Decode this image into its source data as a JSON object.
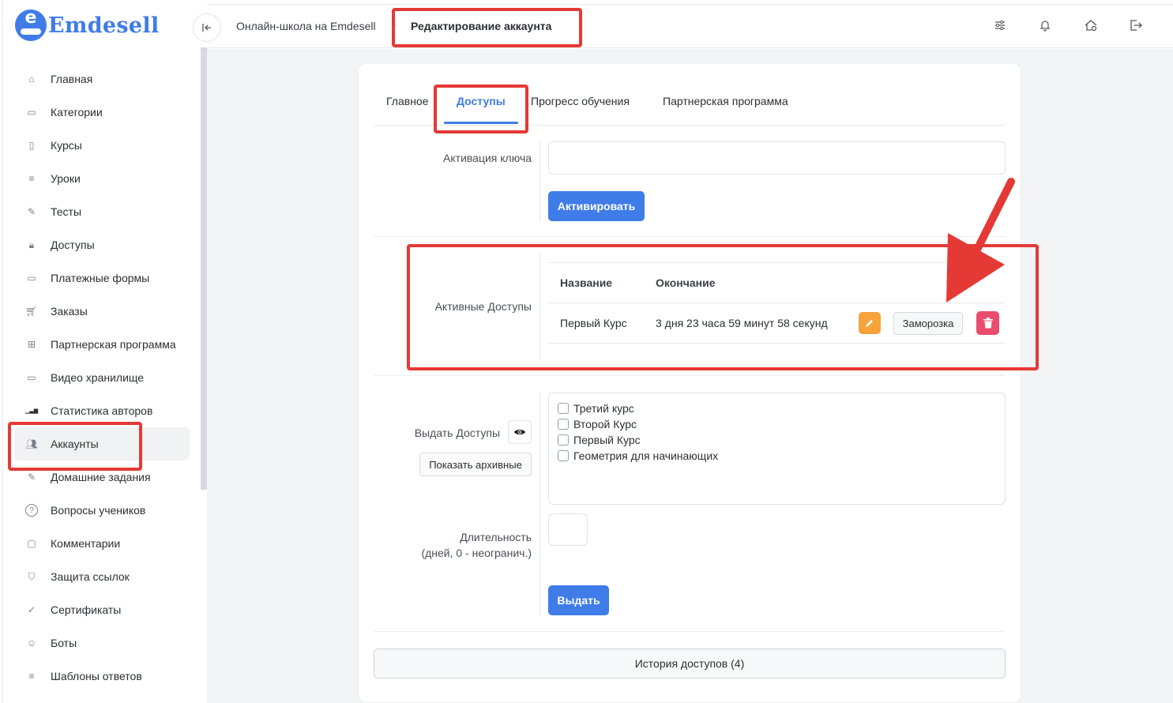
{
  "app": {
    "logo_text": "Emdesell",
    "logo_letter": "e"
  },
  "sidebar": {
    "items": [
      {
        "label": "Главная",
        "icon": "home-icon"
      },
      {
        "label": "Категории",
        "icon": "folder-icon"
      },
      {
        "label": "Курсы",
        "icon": "book-icon"
      },
      {
        "label": "Уроки",
        "icon": "list-icon"
      },
      {
        "label": "Тесты",
        "icon": "edit-icon"
      },
      {
        "label": "Доступы",
        "icon": "lock-icon"
      },
      {
        "label": "Платежные формы",
        "icon": "credit-card-icon"
      },
      {
        "label": "Заказы",
        "icon": "cart-icon"
      },
      {
        "label": "Партнерская программа",
        "icon": "gift-icon"
      },
      {
        "label": "Видео хранилище",
        "icon": "video-icon"
      },
      {
        "label": "Статистика авторов",
        "icon": "bar-chart-icon"
      },
      {
        "label": "Аккаунты",
        "icon": "users-icon",
        "active": true
      },
      {
        "label": "Домашние задания",
        "icon": "pencil-icon"
      },
      {
        "label": "Вопросы учеников",
        "icon": "question-icon"
      },
      {
        "label": "Комментарии",
        "icon": "comment-icon"
      },
      {
        "label": "Защита ссылок",
        "icon": "shield-icon"
      },
      {
        "label": "Сертификаты",
        "icon": "certificate-icon"
      },
      {
        "label": "Боты",
        "icon": "robot-icon"
      },
      {
        "label": "Шаблоны ответов",
        "icon": "list-icon"
      }
    ]
  },
  "breadcrumb": {
    "parent": "Онлайн-школа на Emdesell",
    "current": "Редактирование аккаунта"
  },
  "tabs": [
    "Главное",
    "Доступы",
    "Прогресс обучения",
    "Партнерская программа"
  ],
  "activation": {
    "label": "Активация ключа",
    "button": "Активировать"
  },
  "active_access": {
    "label": "Активные Доступы",
    "columns": [
      "Название",
      "Окончание"
    ],
    "rows": [
      {
        "name": "Первый Курс",
        "ends": "3 дня 23 часа 59 минут 58 секунд",
        "freeze_label": "Заморозка"
      }
    ]
  },
  "grant": {
    "label": "Выдать Доступы",
    "show_archived": "Показать архивные",
    "courses": [
      "Третий курс",
      "Второй Курс",
      "Первый Курс",
      "Геометрия для начинающих"
    ],
    "duration_label_1": "Длительность",
    "duration_label_2": "(дней, 0 - неогранич.)",
    "button": "Выдать"
  },
  "history_button": "История доступов (4)",
  "colors": {
    "accent": "#3f7ce8",
    "edit": "#f6a33b",
    "delete": "#ea4c6d",
    "annotation": "#e53935"
  }
}
